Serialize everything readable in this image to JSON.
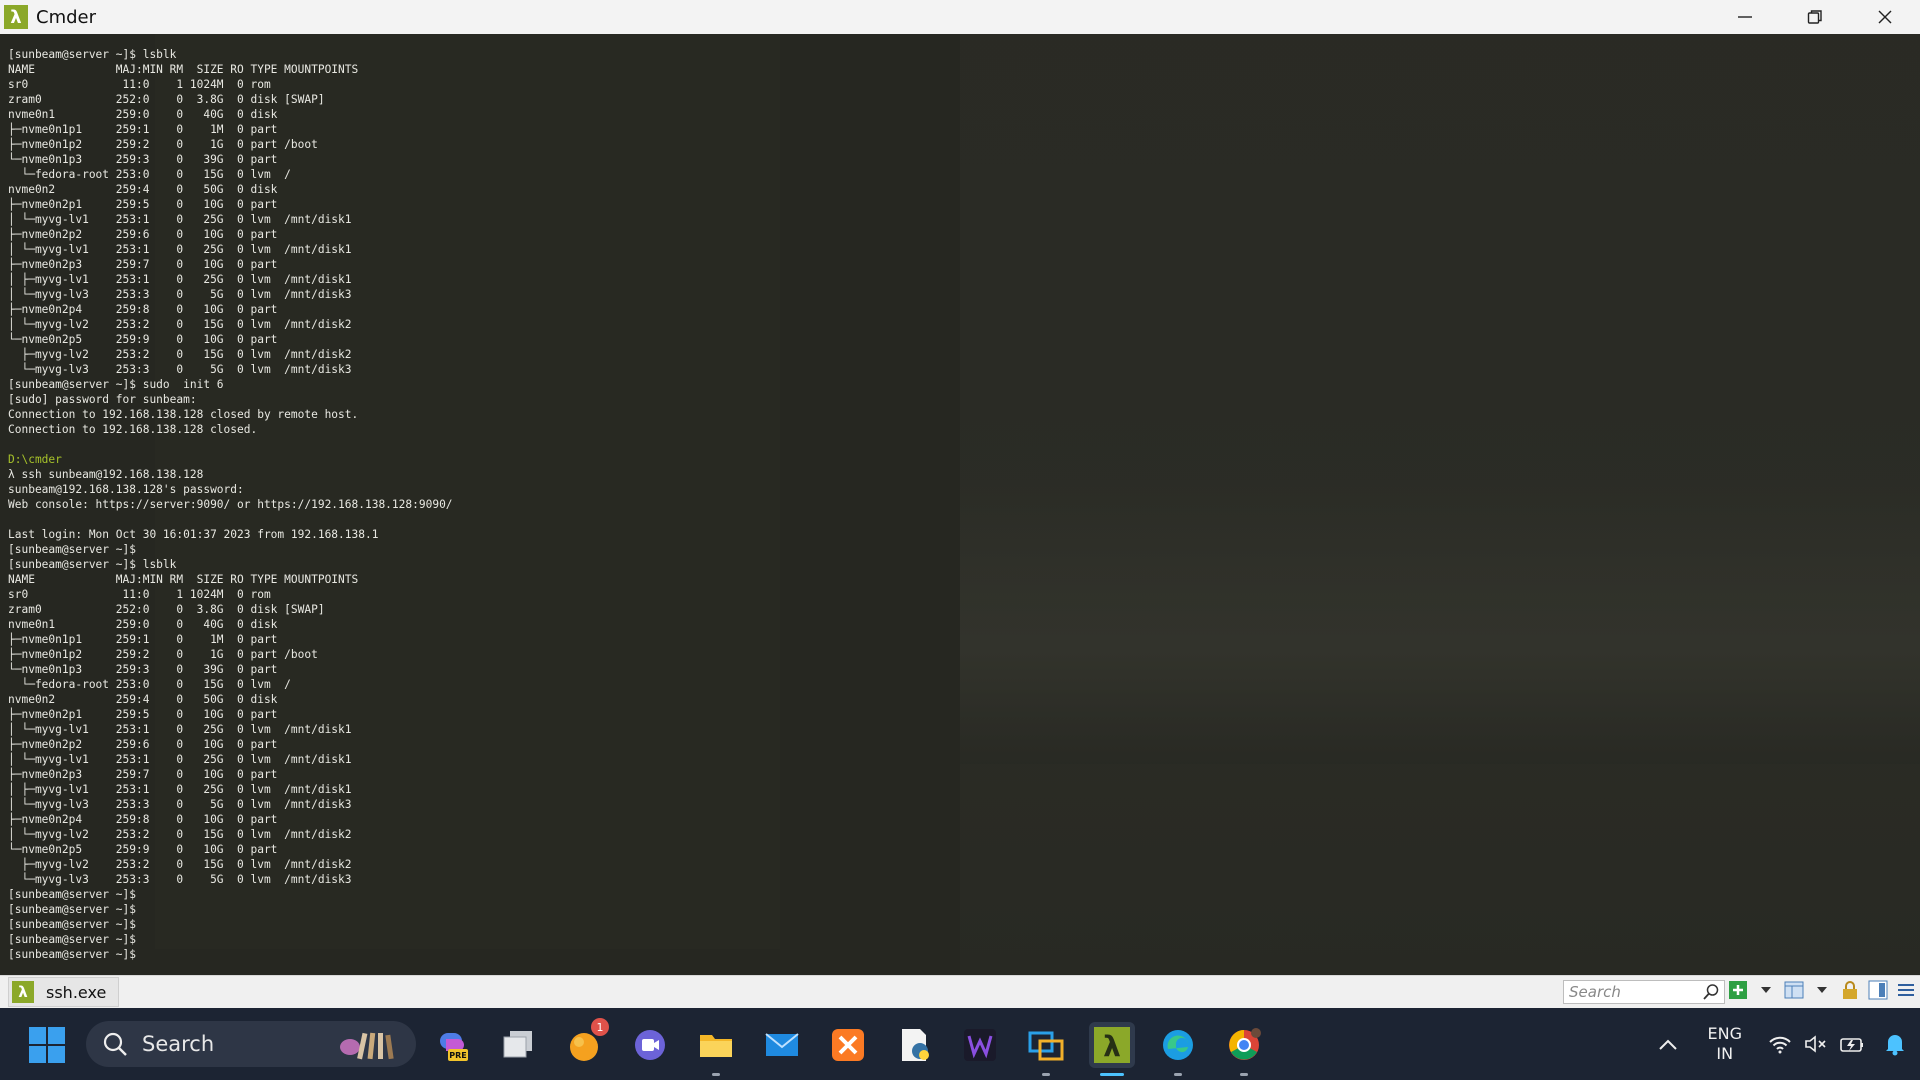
{
  "window": {
    "title": "Cmder"
  },
  "terminal": {
    "lines": [
      {
        "text": "[sunbeam@server ~]$ lsblk"
      },
      {
        "text": "NAME            MAJ:MIN RM  SIZE RO TYPE MOUNTPOINTS"
      },
      {
        "text": "sr0              11:0    1 1024M  0 rom"
      },
      {
        "text": "zram0           252:0    0  3.8G  0 disk [SWAP]"
      },
      {
        "text": "nvme0n1         259:0    0   40G  0 disk"
      },
      {
        "text": "├─nvme0n1p1     259:1    0    1M  0 part"
      },
      {
        "text": "├─nvme0n1p2     259:2    0    1G  0 part /boot"
      },
      {
        "text": "└─nvme0n1p3     259:3    0   39G  0 part"
      },
      {
        "text": "  └─fedora-root 253:0    0   15G  0 lvm  /"
      },
      {
        "text": "nvme0n2         259:4    0   50G  0 disk"
      },
      {
        "text": "├─nvme0n2p1     259:5    0   10G  0 part"
      },
      {
        "text": "│ └─myvg-lv1    253:1    0   25G  0 lvm  /mnt/disk1"
      },
      {
        "text": "├─nvme0n2p2     259:6    0   10G  0 part"
      },
      {
        "text": "│ └─myvg-lv1    253:1    0   25G  0 lvm  /mnt/disk1"
      },
      {
        "text": "├─nvme0n2p3     259:7    0   10G  0 part"
      },
      {
        "text": "│ ├─myvg-lv1    253:1    0   25G  0 lvm  /mnt/disk1"
      },
      {
        "text": "│ └─myvg-lv3    253:3    0    5G  0 lvm  /mnt/disk3"
      },
      {
        "text": "├─nvme0n2p4     259:8    0   10G  0 part"
      },
      {
        "text": "│ └─myvg-lv2    253:2    0   15G  0 lvm  /mnt/disk2"
      },
      {
        "text": "└─nvme0n2p5     259:9    0   10G  0 part"
      },
      {
        "text": "  ├─myvg-lv2    253:2    0   15G  0 lvm  /mnt/disk2"
      },
      {
        "text": "  └─myvg-lv3    253:3    0    5G  0 lvm  /mnt/disk3"
      },
      {
        "text": "[sunbeam@server ~]$ sudo  init 6"
      },
      {
        "text": "[sudo] password for sunbeam:"
      },
      {
        "text": "Connection to 192.168.138.128 closed by remote host."
      },
      {
        "text": "Connection to 192.168.138.128 closed."
      },
      {
        "text": ""
      },
      {
        "text": "D:\\cmder",
        "kind": "path"
      },
      {
        "text": "λ ssh sunbeam@192.168.138.128"
      },
      {
        "text": "sunbeam@192.168.138.128's password:"
      },
      {
        "text": "Web console: https://server:9090/ or https://192.168.138.128:9090/"
      },
      {
        "text": ""
      },
      {
        "text": "Last login: Mon Oct 30 16:01:37 2023 from 192.168.138.1"
      },
      {
        "text": "[sunbeam@server ~]$"
      },
      {
        "text": "[sunbeam@server ~]$ lsblk"
      },
      {
        "text": "NAME            MAJ:MIN RM  SIZE RO TYPE MOUNTPOINTS"
      },
      {
        "text": "sr0              11:0    1 1024M  0 rom"
      },
      {
        "text": "zram0           252:0    0  3.8G  0 disk [SWAP]"
      },
      {
        "text": "nvme0n1         259:0    0   40G  0 disk"
      },
      {
        "text": "├─nvme0n1p1     259:1    0    1M  0 part"
      },
      {
        "text": "├─nvme0n1p2     259:2    0    1G  0 part /boot"
      },
      {
        "text": "└─nvme0n1p3     259:3    0   39G  0 part"
      },
      {
        "text": "  └─fedora-root 253:0    0   15G  0 lvm  /"
      },
      {
        "text": "nvme0n2         259:4    0   50G  0 disk"
      },
      {
        "text": "├─nvme0n2p1     259:5    0   10G  0 part"
      },
      {
        "text": "│ └─myvg-lv1    253:1    0   25G  0 lvm  /mnt/disk1"
      },
      {
        "text": "├─nvme0n2p2     259:6    0   10G  0 part"
      },
      {
        "text": "│ └─myvg-lv1    253:1    0   25G  0 lvm  /mnt/disk1"
      },
      {
        "text": "├─nvme0n2p3     259:7    0   10G  0 part"
      },
      {
        "text": "│ ├─myvg-lv1    253:1    0   25G  0 lvm  /mnt/disk1"
      },
      {
        "text": "│ └─myvg-lv3    253:3    0    5G  0 lvm  /mnt/disk3"
      },
      {
        "text": "├─nvme0n2p4     259:8    0   10G  0 part"
      },
      {
        "text": "│ └─myvg-lv2    253:2    0   15G  0 lvm  /mnt/disk2"
      },
      {
        "text": "└─nvme0n2p5     259:9    0   10G  0 part"
      },
      {
        "text": "  ├─myvg-lv2    253:2    0   15G  0 lvm  /mnt/disk2"
      },
      {
        "text": "  └─myvg-lv3    253:3    0    5G  0 lvm  /mnt/disk3"
      },
      {
        "text": "[sunbeam@server ~]$"
      },
      {
        "text": "[sunbeam@server ~]$"
      },
      {
        "text": "[sunbeam@server ~]$"
      },
      {
        "text": "[sunbeam@server ~]$"
      },
      {
        "text": "[sunbeam@server ~]$"
      }
    ]
  },
  "statusbar": {
    "tab_label": "ssh.exe",
    "search_placeholder": "Search"
  },
  "taskbar": {
    "search_label": "Search",
    "apps": [
      {
        "name": "copilot-pre",
        "icon": "copilot-icon"
      },
      {
        "name": "task-view",
        "icon": "task-view-icon"
      },
      {
        "name": "orange-app",
        "icon": "orange-circle-icon",
        "badge": "1"
      },
      {
        "name": "meet",
        "icon": "video-chat-icon"
      },
      {
        "name": "file-explorer",
        "icon": "folder-icon"
      },
      {
        "name": "mail",
        "icon": "mail-icon"
      },
      {
        "name": "xampp",
        "icon": "xampp-icon"
      },
      {
        "name": "python-files",
        "icon": "python-file-icon"
      },
      {
        "name": "w-app",
        "icon": "w-letter-icon"
      },
      {
        "name": "remote-app",
        "icon": "remote-desktop-icon"
      },
      {
        "name": "cmder",
        "icon": "lambda-icon"
      },
      {
        "name": "edge",
        "icon": "edge-icon"
      },
      {
        "name": "chrome",
        "icon": "chrome-icon"
      }
    ],
    "lang_top": "ENG",
    "lang_bottom": "IN"
  },
  "colors": {
    "terminal_bg": "#262721",
    "terminal_fg": "#e8e8e2",
    "path_green": "#a6c12a",
    "cmder_green": "#8ba829",
    "taskbar_bg": "#1c2433"
  }
}
